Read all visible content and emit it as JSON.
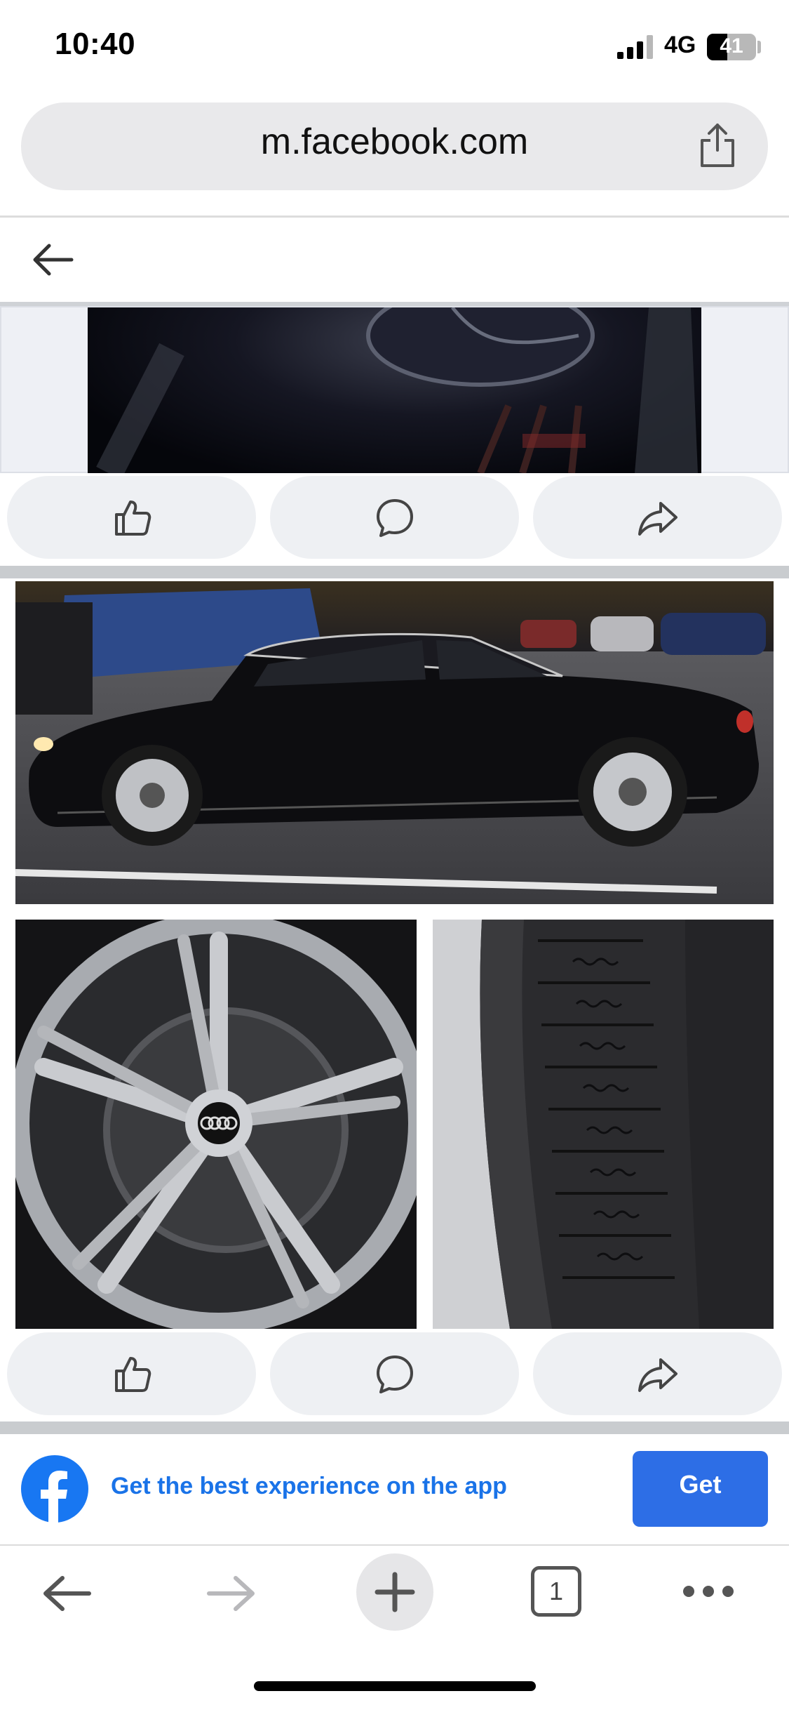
{
  "status_bar": {
    "time": "10:40",
    "network": "4G",
    "battery": "41"
  },
  "browser": {
    "url": "m.facebook.com"
  },
  "posts": [
    {
      "actions": [
        "like",
        "comment",
        "share"
      ]
    },
    {
      "actions": [
        "like",
        "comment",
        "share"
      ]
    }
  ],
  "app_banner": {
    "text": "Get the best experience on the app",
    "button": "Get"
  },
  "toolbar": {
    "tab_count": "1"
  },
  "colors": {
    "accent": "#1a73e8",
    "fb_blue": "#1877f2",
    "button_blue": "#2d6ee6"
  }
}
